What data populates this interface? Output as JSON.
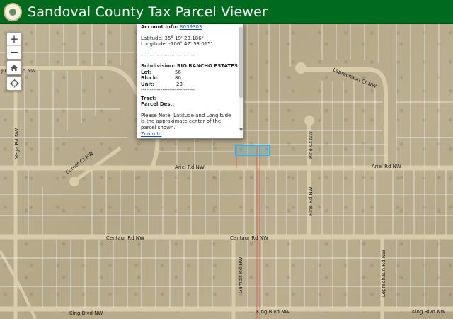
{
  "header": {
    "title": "Sandoval County Tax Parcel Viewer",
    "background": "#006b1f"
  },
  "controls": {
    "zoom_in": "+",
    "zoom_out": "−",
    "home_icon": "home-icon",
    "locate_icon": "locate-icon"
  },
  "popup": {
    "account_label": "Account Info:",
    "account_value": "R039303",
    "latitude": "Latitude: 35° 19' 23.186\"",
    "longitude": "Longitude: -106° 47' 53.015\"",
    "divider": "------------------------------",
    "subdivision": "Subdivision: RIO RANCHO ESTATES",
    "lot_label": "Lot:",
    "lot_value": "56",
    "block_label": "Block:",
    "block_value": "80",
    "unit_label": "Unit:",
    "unit_value": "23",
    "divider2": "------------------------------",
    "tract": "Tract:",
    "parcel_des": "Parcel Des.:",
    "note": "Please Note: Latitude and Longitude is the approximate center of the parcel shown.",
    "zoom_link": "Zoom to"
  },
  "map": {
    "roads": [
      "Jupiter Rd NW",
      "Vega Rd NW",
      "Comet Ct NW",
      "Leprechaun Ct NW",
      "Pine Ct NW",
      "Ariel Rd NW",
      "Ariel Rd NW",
      "Pine Rd NW",
      "Centaur Rd NW",
      "Centaur Rd NW",
      "Gambit Rd NW",
      "Leprechaun Rd NW",
      "King Blvd NW",
      "King Blvd NW",
      "King Blvd NW"
    ],
    "selected_parcel_color": "#3ab0e0",
    "parcel_line_color": "#ffffff",
    "highlight_line_color": "#e05050"
  }
}
